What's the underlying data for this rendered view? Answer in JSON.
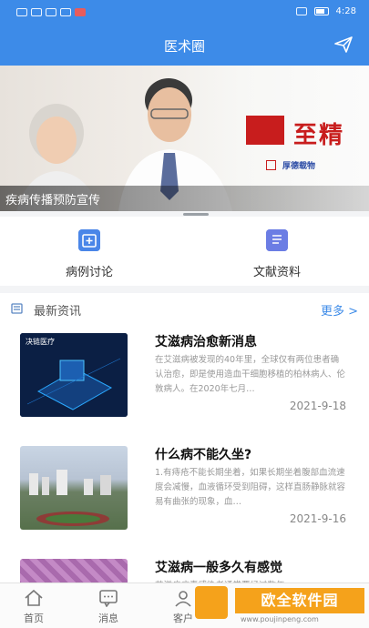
{
  "status_bar": {
    "time": "4:28"
  },
  "header": {
    "title": "医术圈"
  },
  "banner": {
    "logo_text": "至精",
    "brand_text": "厚德载物",
    "caption": "疾病传播预防宣传"
  },
  "quick_entries": [
    {
      "label": "病例讨论",
      "icon": "case-discussion-icon"
    },
    {
      "label": "文献资料",
      "icon": "document-icon"
    }
  ],
  "news": {
    "title": "最新资讯",
    "more": "更多 >",
    "items": [
      {
        "title": "艾滋病治愈新消息",
        "body": "在艾滋病被发现的40年里，全球仅有两位患者确认治愈，即是使用造血干细胞移植的柏林病人、伦敦病人。在2020年七月…",
        "date": "2021-9-18",
        "thumb_text": "决链医疗"
      },
      {
        "title": "什么病不能久坐?",
        "body": "1.有痔疮不能长期坐着，如果长期坐着腹部血流速度会减慢，血液循环受到阻碍，这样直肠静脉就容易有曲张的现象，血…",
        "date": "2021-9-16"
      },
      {
        "title": "艾滋病一般多久有感觉",
        "body": "艾滋病病毒感染者通常要经过数年…",
        "date": ""
      }
    ]
  },
  "bottom_nav": [
    {
      "label": "首页",
      "icon": "home-icon"
    },
    {
      "label": "消息",
      "icon": "message-icon"
    },
    {
      "label": "客户",
      "icon": "customer-icon"
    }
  ],
  "watermark": {
    "text": "欧全软件园",
    "url": "www.poujinpeng.com"
  }
}
